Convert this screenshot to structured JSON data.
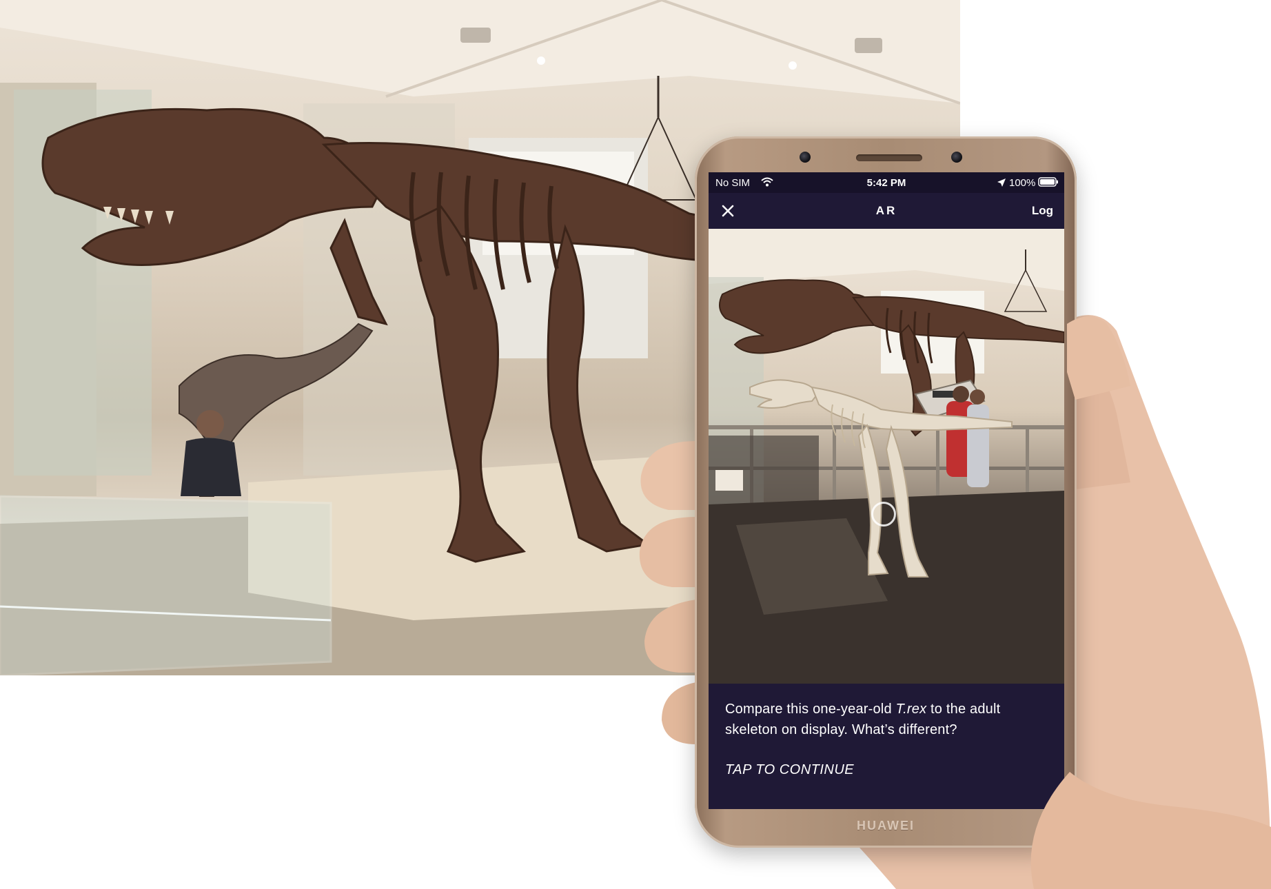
{
  "phone": {
    "brand": "HUAWEI",
    "status_bar": {
      "carrier": "No SIM",
      "time": "5:42 PM",
      "battery": "100%"
    },
    "nav": {
      "title": "AR",
      "close_icon": "close-icon",
      "log_label": "Log"
    },
    "caption": {
      "text_before": "Compare this one-year-old ",
      "text_italic": "T.rex",
      "text_after": " to the adult skeleton on display. What’s different?",
      "cta": "TAP TO CONTINUE"
    }
  },
  "colors": {
    "app_background": "#1f1936",
    "status_bar": "#171229",
    "phone_body": "#a88c74",
    "text": "#ffffff"
  },
  "icons": [
    "wifi-icon",
    "location-arrow-icon",
    "battery-icon",
    "close-icon"
  ]
}
